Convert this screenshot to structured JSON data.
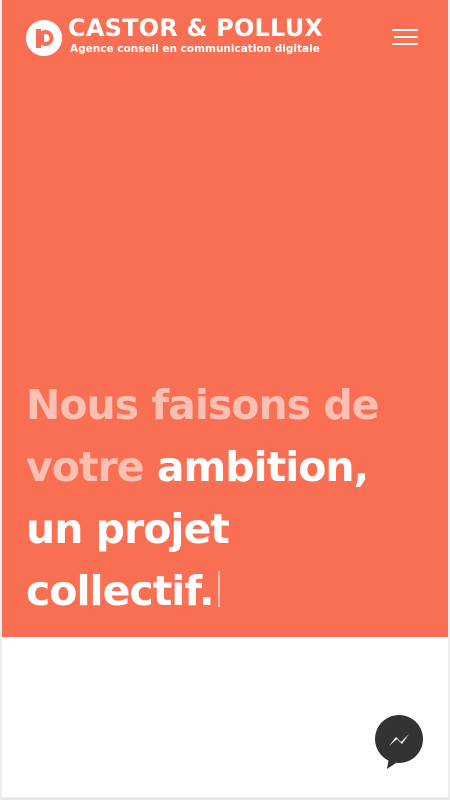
{
  "brand": {
    "name": "CASTOR & POLLUX",
    "tagline": "Agence conseil en communication digitale",
    "logo_icon": "castor-pollux-logo-icon"
  },
  "header": {
    "menu_icon": "hamburger-menu-icon"
  },
  "hero": {
    "headline": {
      "line1": "Nous faisons de",
      "line2_soft": "votre",
      "line2_strong": "ambition,",
      "line3": "un projet",
      "line4": "collectif."
    }
  },
  "chat": {
    "icon": "messenger-icon"
  },
  "colors": {
    "hero_background": "#f86f53",
    "headline_soft": "#fbc0b2",
    "headline_strong": "#ffffff",
    "messenger_bubble": "#333333"
  }
}
